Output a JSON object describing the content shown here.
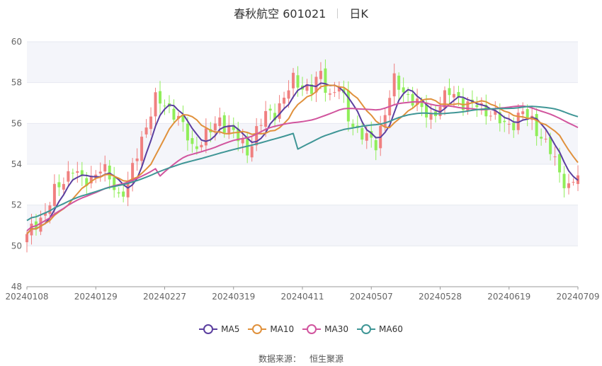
{
  "header": {
    "stock_name": "春秋航空 601021",
    "period": "日K"
  },
  "footer": {
    "source_label": "数据来源：",
    "source_value": "恒生聚源"
  },
  "colors": {
    "up": "#f08080",
    "down": "#90ee5a",
    "MA5": "#5b3f9f",
    "MA10": "#e0913c",
    "MA30": "#d1559e",
    "MA60": "#3f9696",
    "grid": "#e6e9f0",
    "band": "#f4f5fa",
    "axis_text": "#666666"
  },
  "chart_data": {
    "type": "candlestick",
    "ylim": [
      48,
      60
    ],
    "yticks": [
      48,
      50,
      52,
      54,
      56,
      58,
      60
    ],
    "xtick_labels": [
      "20240108",
      "20240129",
      "20240227",
      "20240319",
      "20240411",
      "20240507",
      "20240528",
      "20240619",
      "20240709"
    ],
    "trading_days": 121,
    "legend": [
      {
        "name": "MA5",
        "color": "#5b3f9f"
      },
      {
        "name": "MA10",
        "color": "#e0913c"
      },
      {
        "name": "MA30",
        "color": "#d1559e"
      },
      {
        "name": "MA60",
        "color": "#3f9696"
      }
    ],
    "anchors": [
      [
        0,
        50.4
      ],
      [
        2,
        51.2
      ],
      [
        4,
        51.6
      ],
      [
        6,
        52.6
      ],
      [
        8,
        53.3
      ],
      [
        10,
        53.8
      ],
      [
        12,
        53.1
      ],
      [
        14,
        53.4
      ],
      [
        16,
        53.8
      ],
      [
        18,
        53.3
      ],
      [
        20,
        52.5
      ],
      [
        22,
        53.0
      ],
      [
        24,
        54.5
      ],
      [
        26,
        56.0
      ],
      [
        28,
        57.1
      ],
      [
        30,
        56.9
      ],
      [
        32,
        56.6
      ],
      [
        34,
        55.8
      ],
      [
        36,
        54.8
      ],
      [
        38,
        55.2
      ],
      [
        40,
        55.6
      ],
      [
        42,
        56.2
      ],
      [
        44,
        55.8
      ],
      [
        46,
        55.2
      ],
      [
        48,
        54.7
      ],
      [
        50,
        55.6
      ],
      [
        52,
        56.4
      ],
      [
        54,
        56.6
      ],
      [
        56,
        57.2
      ],
      [
        58,
        58.1
      ],
      [
        60,
        57.9
      ],
      [
        62,
        57.6
      ],
      [
        64,
        58.4
      ],
      [
        66,
        57.4
      ],
      [
        68,
        57.8
      ],
      [
        70,
        56.3
      ],
      [
        72,
        55.7
      ],
      [
        74,
        55.2
      ],
      [
        76,
        55.0
      ],
      [
        78,
        56.6
      ],
      [
        80,
        58.0
      ],
      [
        82,
        57.6
      ],
      [
        84,
        57.2
      ],
      [
        86,
        56.6
      ],
      [
        88,
        56.4
      ],
      [
        90,
        56.9
      ],
      [
        92,
        57.5
      ],
      [
        94,
        57.3
      ],
      [
        96,
        56.8
      ],
      [
        98,
        56.9
      ],
      [
        100,
        56.7
      ],
      [
        102,
        56.3
      ],
      [
        104,
        55.9
      ],
      [
        106,
        56.1
      ],
      [
        108,
        56.5
      ],
      [
        110,
        56.1
      ],
      [
        112,
        55.4
      ],
      [
        114,
        54.6
      ],
      [
        116,
        53.6
      ],
      [
        118,
        52.9
      ],
      [
        120,
        53.4
      ]
    ]
  }
}
